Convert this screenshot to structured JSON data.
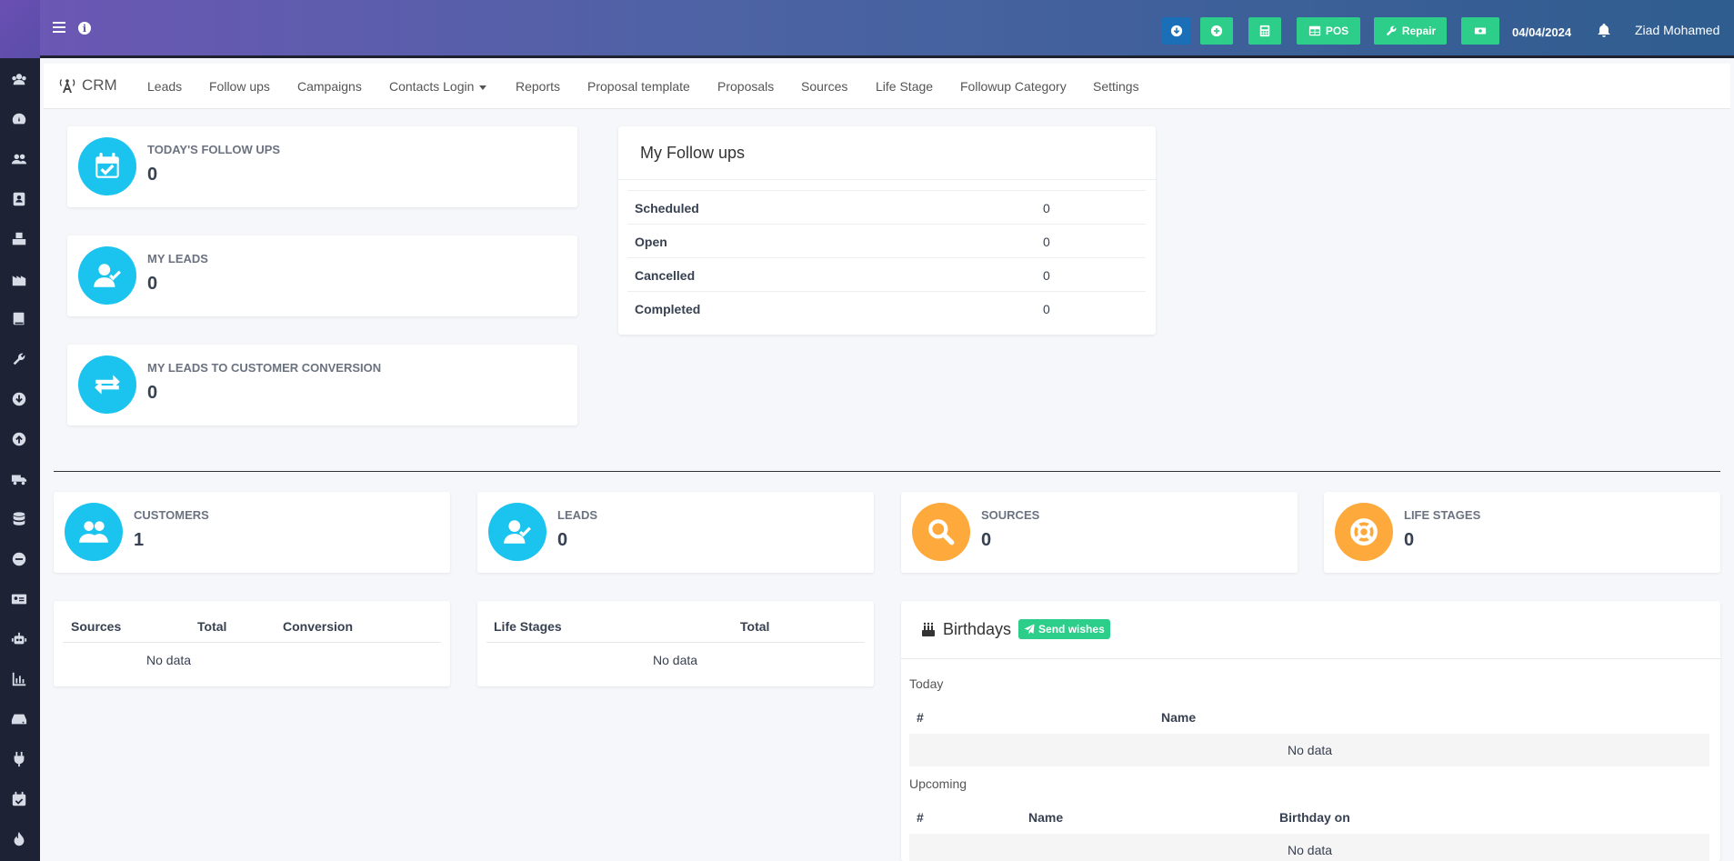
{
  "topbar": {
    "date": "04/04/2024",
    "user": "Ziad Mohamed",
    "pos_label": "POS",
    "repair_label": "Repair",
    "colors": {
      "download_btn": "#1a6fb8",
      "green_btn": "#2dce89"
    }
  },
  "crm_nav": {
    "brand": "CRM",
    "items": [
      {
        "label": "Leads"
      },
      {
        "label": "Follow ups"
      },
      {
        "label": "Campaigns"
      },
      {
        "label": "Contacts Login"
      },
      {
        "label": "Reports"
      },
      {
        "label": "Proposal template"
      },
      {
        "label": "Proposals"
      },
      {
        "label": "Sources"
      },
      {
        "label": "Life Stage"
      },
      {
        "label": "Followup Category"
      },
      {
        "label": "Settings"
      }
    ]
  },
  "top_stats": [
    {
      "label": "Today's Follow ups",
      "value": "0",
      "icon": "calendar-check-icon"
    },
    {
      "label": "My Leads",
      "value": "0",
      "icon": "user-check-icon"
    },
    {
      "label": "My Leads to customer conversion",
      "value": "0",
      "icon": "exchange-icon"
    }
  ],
  "my_followups": {
    "title": "My Follow ups",
    "rows": [
      {
        "label": "Scheduled",
        "value": "0"
      },
      {
        "label": "Open",
        "value": "0"
      },
      {
        "label": "Cancelled",
        "value": "0"
      },
      {
        "label": "Completed",
        "value": "0"
      }
    ]
  },
  "bottom_stats": [
    {
      "label": "Customers",
      "value": "1",
      "icon": "users-icon",
      "color": "#1ac4ee"
    },
    {
      "label": "Leads",
      "value": "0",
      "icon": "user-check-icon",
      "color": "#1ac4ee"
    },
    {
      "label": "Sources",
      "value": "0",
      "icon": "search-icon",
      "color": "#fda93b"
    },
    {
      "label": "Life Stages",
      "value": "0",
      "icon": "life-ring-icon",
      "color": "#fda93b"
    }
  ],
  "sources_table": {
    "headers": [
      "Sources",
      "Total",
      "Conversion"
    ],
    "empty": "No data"
  },
  "life_stages_table": {
    "headers": [
      "Life Stages",
      "Total"
    ],
    "empty": "No data"
  },
  "birthdays": {
    "title": "Birthdays",
    "send_label": "Send wishes",
    "today_label": "Today",
    "today_headers": [
      "#",
      "Name"
    ],
    "today_empty": "No data",
    "upcoming_label": "Upcoming",
    "upcoming_headers": [
      "#",
      "Name",
      "Birthday on"
    ],
    "upcoming_empty": "No data"
  }
}
